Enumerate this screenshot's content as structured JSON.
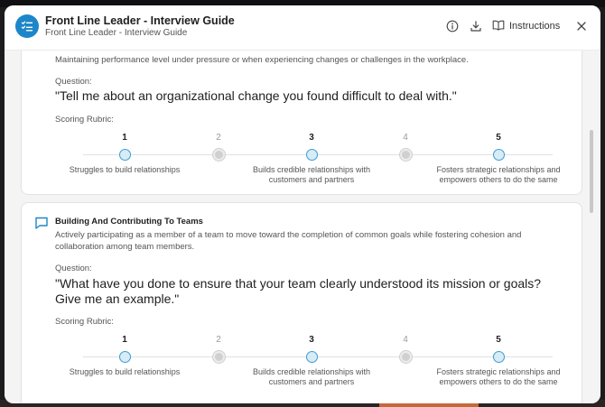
{
  "header": {
    "title": "Front Line Leader - Interview Guide",
    "subtitle": "Front Line Leader - Interview Guide",
    "instructions_label": "Instructions"
  },
  "icons": {
    "app": "checklist-icon",
    "info": "info-icon",
    "download": "download-icon",
    "instructions": "book-icon",
    "close": "close-icon",
    "competency": "chat-bubble-icon"
  },
  "colors": {
    "accent": "#1d86c9",
    "rubric_point": "#3f9bd0"
  },
  "cards": [
    {
      "description": "Maintaining performance level under pressure or when experiencing changes or challenges in the workplace.",
      "question_label": "Question:",
      "question": "\"Tell me about an organizational change you found difficult to deal with.\"",
      "rubric_label": "Scoring Rubric:",
      "rubric": [
        {
          "score": "1",
          "desc": "Struggles to build relationships"
        },
        {
          "score": "2",
          "desc": ""
        },
        {
          "score": "3",
          "desc": "Builds credible relationships with customers and partners"
        },
        {
          "score": "4",
          "desc": ""
        },
        {
          "score": "5",
          "desc": "Fosters strategic relationships and empowers others to do the same"
        }
      ]
    },
    {
      "title": "Building And Contributing To Teams",
      "description": "Actively participating as a member of a team to move toward the completion of common goals while fostering cohesion and collaboration among team members.",
      "question_label": "Question:",
      "question": "\"What have you done to ensure that your team clearly understood its mission or goals? Give me an example.\"",
      "rubric_label": "Scoring Rubric:",
      "rubric": [
        {
          "score": "1",
          "desc": "Struggles to build relationships"
        },
        {
          "score": "2",
          "desc": ""
        },
        {
          "score": "3",
          "desc": "Builds credible relationships with customers and partners"
        },
        {
          "score": "4",
          "desc": ""
        },
        {
          "score": "5",
          "desc": "Fosters strategic relationships and empowers others to do the same"
        }
      ]
    }
  ]
}
